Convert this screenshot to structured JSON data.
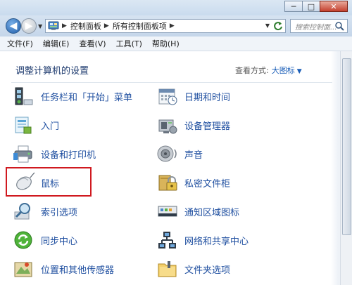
{
  "window": {
    "controls": {
      "minimize": "─",
      "maximize": "□",
      "close": "✕"
    }
  },
  "address": {
    "crumbs": [
      "控制面板",
      "所有控制面板项"
    ],
    "search_placeholder": "搜索控制面..."
  },
  "menu": [
    "文件(F)",
    "编辑(E)",
    "查看(V)",
    "工具(T)",
    "帮助(H)"
  ],
  "content": {
    "heading": "调整计算机的设置",
    "view_by_label": "查看方式:",
    "view_by_value": "大图标",
    "left_items": [
      {
        "label": "任务栏和「开始」菜单",
        "icon": "taskbar-icon"
      },
      {
        "label": "入门",
        "icon": "getting-started-icon"
      },
      {
        "label": "设备和打印机",
        "icon": "printer-icon"
      },
      {
        "label": "鼠标",
        "icon": "mouse-icon"
      },
      {
        "label": "索引选项",
        "icon": "indexing-icon"
      },
      {
        "label": "同步中心",
        "icon": "sync-icon"
      },
      {
        "label": "位置和其他传感器",
        "icon": "location-icon"
      }
    ],
    "right_items": [
      {
        "label": "日期和时间",
        "icon": "calendar-icon"
      },
      {
        "label": "设备管理器",
        "icon": "device-manager-icon"
      },
      {
        "label": "声音",
        "icon": "speaker-icon"
      },
      {
        "label": "私密文件柜",
        "icon": "locker-icon"
      },
      {
        "label": "通知区域图标",
        "icon": "notification-icon"
      },
      {
        "label": "网络和共享中心",
        "icon": "network-icon"
      },
      {
        "label": "文件夹选项",
        "icon": "folder-options-icon"
      }
    ]
  },
  "colors": {
    "link": "#1f4fa0",
    "highlight_border": "#d0191f"
  }
}
